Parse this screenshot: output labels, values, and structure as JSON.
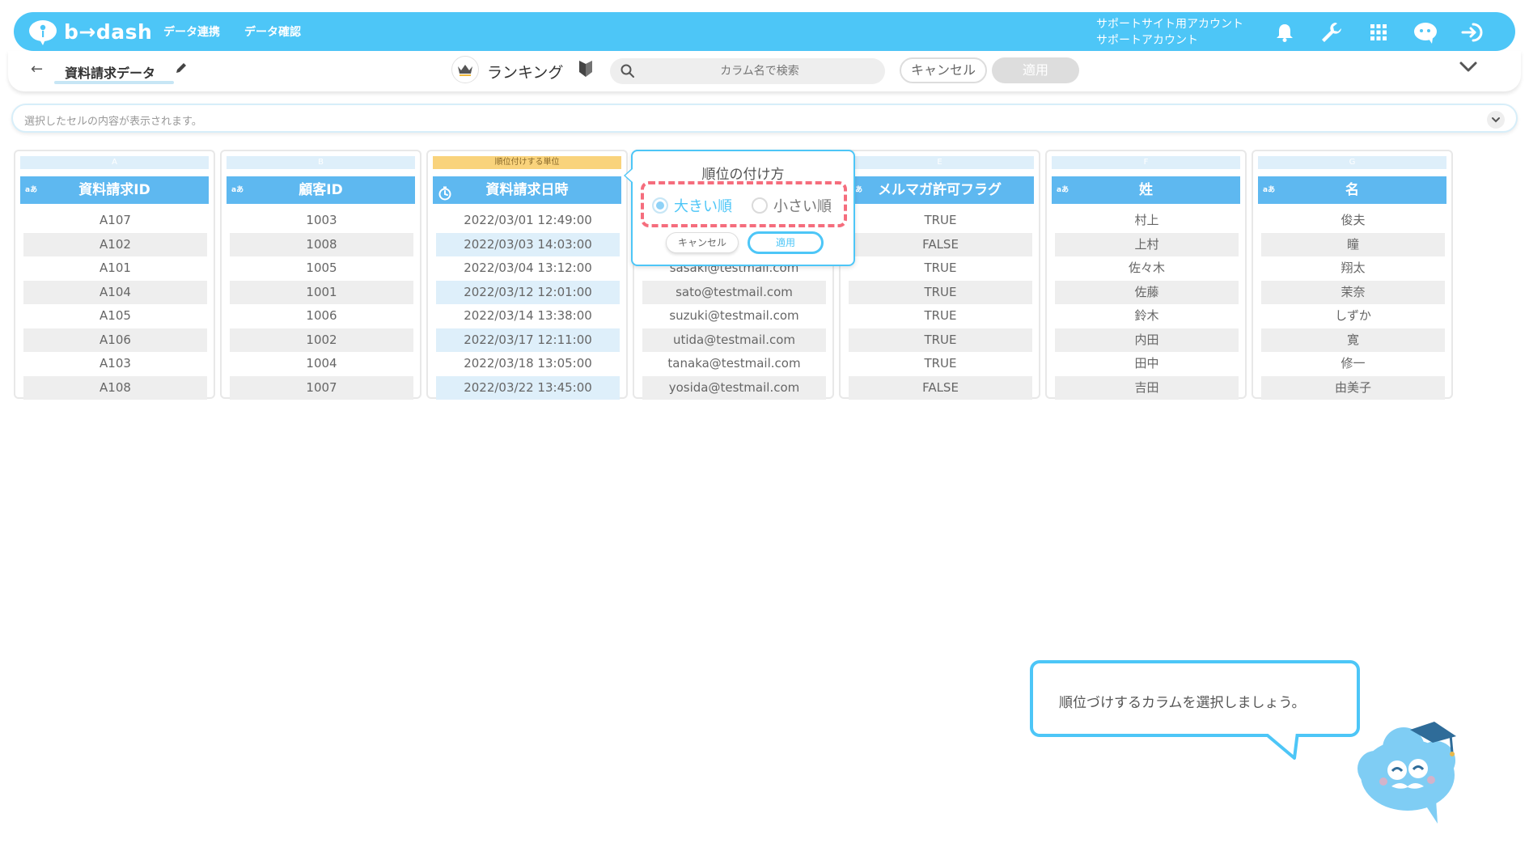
{
  "app": {
    "logo_text": "b→dash"
  },
  "topnav": [
    "データ連携",
    "データ確認"
  ],
  "account": {
    "line1": "サポートサイト用アカウント",
    "line2": "サポートアカウント"
  },
  "subheader": {
    "dataset_name": "資料請求データ",
    "mode_label": "ランキング",
    "search_placeholder": "カラム名で検索",
    "cancel_label": "キャンセル",
    "apply_label": "適用"
  },
  "cellbar": {
    "placeholder": "選択したセルの内容が表示されます。"
  },
  "columns": [
    {
      "letter": "A",
      "type": "aあ",
      "header": "資料請求ID",
      "cells": [
        "A107",
        "A102",
        "A101",
        "A104",
        "A105",
        "A106",
        "A103",
        "A108"
      ]
    },
    {
      "letter": "B",
      "type": "aあ",
      "header": "顧客ID",
      "cells": [
        "1003",
        "1008",
        "1005",
        "1001",
        "1006",
        "1002",
        "1004",
        "1007"
      ]
    },
    {
      "letter": "順位付けする単位",
      "type": "",
      "header": "資料請求日時",
      "cells": [
        "2022/03/01 12:49:00",
        "2022/03/03 14:03:00",
        "2022/03/04 13:12:00",
        "2022/03/12 12:01:00",
        "2022/03/14 13:38:00",
        "2022/03/17 12:11:00",
        "2022/03/18 13:05:00",
        "2022/03/22 13:45:00"
      ]
    },
    {
      "letter": "D",
      "type": "aあ",
      "header": "",
      "cells": [
        "",
        "",
        "sasaki@testmail.com",
        "sato@testmail.com",
        "suzuki@testmail.com",
        "utida@testmail.com",
        "tanaka@testmail.com",
        "yosida@testmail.com"
      ]
    },
    {
      "letter": "E",
      "type": "aあ",
      "header": "メルマガ許可フラグ",
      "cells": [
        "TRUE",
        "FALSE",
        "TRUE",
        "TRUE",
        "TRUE",
        "TRUE",
        "TRUE",
        "FALSE"
      ]
    },
    {
      "letter": "F",
      "type": "aあ",
      "header": "姓",
      "cells": [
        "村上",
        "上村",
        "佐々木",
        "佐藤",
        "鈴木",
        "内田",
        "田中",
        "吉田"
      ]
    },
    {
      "letter": "G",
      "type": "aあ",
      "header": "名",
      "cells": [
        "俊夫",
        "瞳",
        "翔太",
        "茉奈",
        "しずか",
        "寛",
        "修一",
        "由美子"
      ]
    }
  ],
  "popup": {
    "title": "順位の付け方",
    "option_desc": "大きい順",
    "option_asc": "小さい順",
    "selected": "大きい順",
    "cancel_label": "キャンセル",
    "apply_label": "適用"
  },
  "tutorial": {
    "message": "順位づけするカラムを選択しましょう。"
  },
  "colors": {
    "accent": "#4dc6f7",
    "header": "#5eb8f0",
    "highlight": "#f56d7d",
    "unit": "#f9d37c"
  }
}
